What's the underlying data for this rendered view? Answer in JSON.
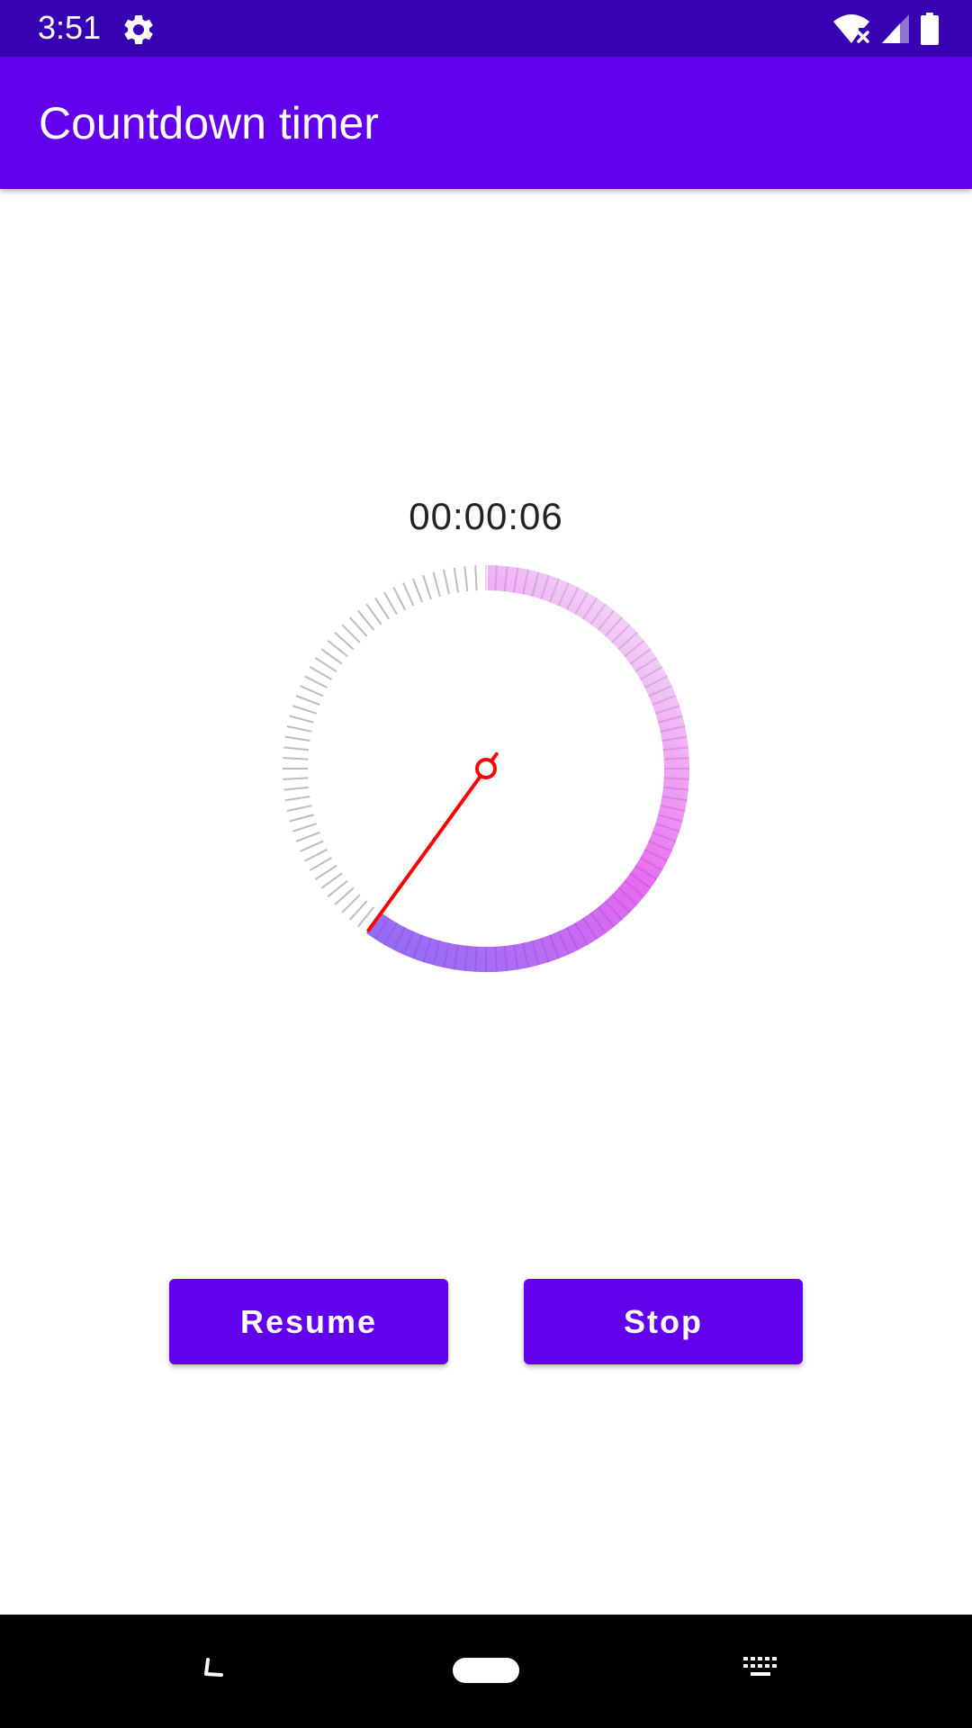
{
  "status_bar": {
    "time": "3:51",
    "icons": [
      "settings-gear-icon",
      "wifi-no-internet-icon",
      "cell-signal-icon",
      "battery-icon"
    ],
    "color": "#3700b3"
  },
  "app_bar": {
    "title": "Countdown timer",
    "color": "#6200ee"
  },
  "timer": {
    "display": "00:00:06",
    "elapsed_fraction": 0.4,
    "remaining_gradient": [
      "#8b6cf7",
      "#e86bf0",
      "#f3d4f6"
    ],
    "elapsed_tick_color": "#bdbdbd",
    "hand_color": "#ff0000"
  },
  "actions": {
    "resume_label": "Resume",
    "stop_label": "Stop",
    "color": "#6200ee"
  },
  "nav_bar": {
    "icons": [
      "back-icon",
      "home-pill-icon",
      "keyboard-icon"
    ]
  }
}
